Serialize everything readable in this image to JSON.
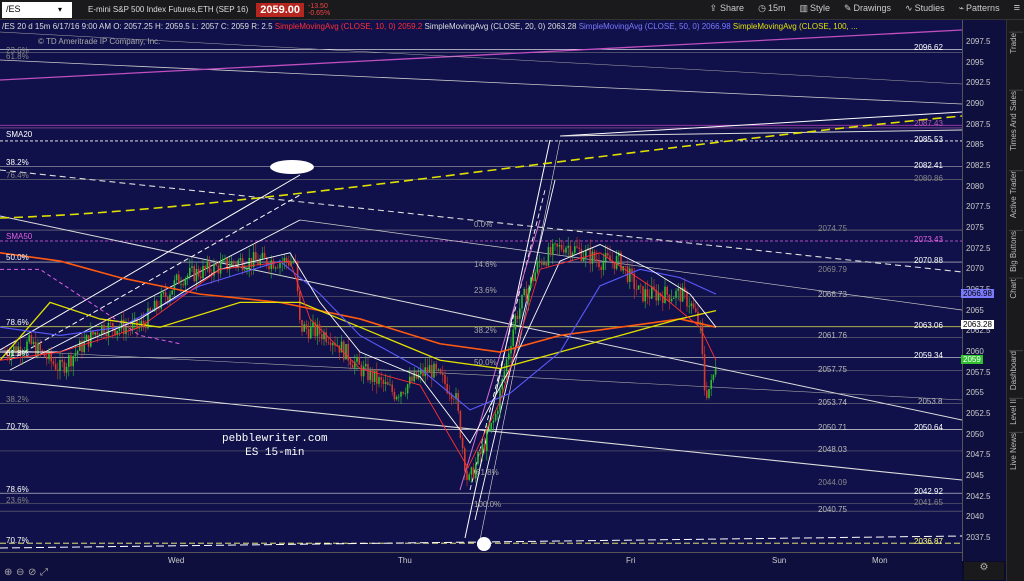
{
  "header": {
    "symbol": "/ES",
    "description": "E-mini S&P 500 Index Futures,ETH (SEP 16)",
    "price": "2059.00",
    "change": "-13.50",
    "change_pct": "-0.65%"
  },
  "toolbar": {
    "share": "Share",
    "interval": "15m",
    "style": "Style",
    "drawings": "Drawings",
    "studies": "Studies",
    "patterns": "Patterns"
  },
  "study_line": {
    "prefix": "/ES 20 d 15m",
    "date": "6/17/16 9:00 AM",
    "open": "O: 2057.25",
    "high": "H: 2059.5",
    "low": "L: 2057",
    "close": "C: 2059",
    "range": "R: 2.5",
    "sma10": "SimpleMovingAvg (CLOSE, 10, 0)",
    "sma10v": "2059.2",
    "sma20": "SimpleMovingAvg (CLOSE, 20, 0)",
    "sma20v": "2063.28",
    "sma50": "SimpleMovingAvg (CLOSE, 50, 0)",
    "sma50v": "2066.98",
    "sma100": "SimpleMovingAvg (CLOSE, 100, ..."
  },
  "copyright": "© TD Ameritrade IP Company, Inc.",
  "watermark": {
    "line1": "pebblewriter.com",
    "line2": "ES 15-min"
  },
  "sidebar_tabs": [
    "Trade",
    "Times And Sales",
    "Active Trader",
    "Big Buttons",
    "Chart",
    "Dashboard",
    "Level II",
    "Live News"
  ],
  "yaxis_ticks": [
    "2097.5",
    "2095",
    "2092.5",
    "2090",
    "2087.5",
    "2085",
    "2082.5",
    "2080",
    "2077.5",
    "2075",
    "2072.5",
    "2070",
    "2067.5",
    "2065",
    "2062.5",
    "2060",
    "2057.5",
    "2055",
    "2052.5",
    "2050",
    "2047.5",
    "2045",
    "2042.5",
    "2040",
    "2037.5"
  ],
  "xaxis_labels": [
    "Wed",
    "Thu",
    "Fri",
    "Sun",
    "Mon"
  ],
  "price_tags": {
    "t1": "2066.98",
    "t2": "2063.28",
    "t3": "2059"
  },
  "levels_left": {
    "l1": "23.6%",
    "l2": "61.8%",
    "l3": "SMA20",
    "l4": "38.2%",
    "l5": "76.4%",
    "l6": "SMA50",
    "l7": "50.0%",
    "l8": "78.6%",
    "l9": "61.8%",
    "l10": "38.2%",
    "l11": "70.7%",
    "l12": "78.6%",
    "l13": "23.6%",
    "l14": "70.7%"
  },
  "levels_right": {
    "r1": "2096.62",
    "r2": "2087.43",
    "r3": "2085.53",
    "r4": "2082.41",
    "r5": "2080.86",
    "r6": "2074.75",
    "r7": "2073.43",
    "r8": "2070.88",
    "r9": "2069.79",
    "r10": "2066.73",
    "r11": "2063.06",
    "r12": "2061.76",
    "r13": "2059.34",
    "r14": "2057.75",
    "r15": "2053.74",
    "r16": "2053.8",
    "r17": "2050.71",
    "r18": "2050.64",
    "r19": "2048.03",
    "r20": "2044.09",
    "r21": "2042.92",
    "r22": "2041.65",
    "r23": "2040.75",
    "r24": "2036.87"
  },
  "mid_levels": {
    "m1": "14.6%",
    "m2": "23.6%",
    "m3": "38.2%",
    "m4": "50.0%",
    "m5": "0.0%",
    "m6": "61.8%",
    "m7": "100.0%"
  },
  "colors": {
    "bg": "#10104a",
    "up": "#2fbf2f",
    "down": "#d63a2a",
    "sma10": "#ff3030",
    "sma20": "#ffffff",
    "sma50": "#5a5aff",
    "sma100": "#e0e000",
    "sma200": "#ff5a10",
    "pink": "#e060e0"
  }
}
